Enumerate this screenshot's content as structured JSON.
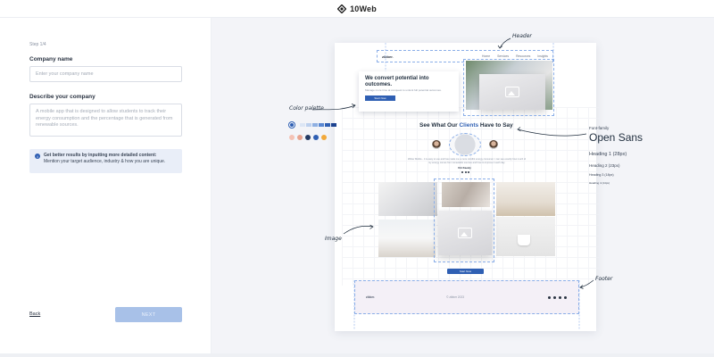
{
  "topbar": {
    "brand": "10Web",
    "logo_icon": "diamond-logo-icon"
  },
  "form": {
    "step": "Step 1/4",
    "company_name_label": "Company name",
    "company_name_placeholder": "Enter your company name",
    "describe_label": "Describe your company",
    "describe_placeholder": "A mobile app that is designed to allow students to track their energy consumption and the percentage that is generated from renewable sources.",
    "tip_title": "Get better results by inputting more detailed content:",
    "tip_body": "Mention your target audience, industry & how you are unique.",
    "back_label": "Back",
    "next_label": "NEXT"
  },
  "preview": {
    "header": {
      "logo": "zibber.",
      "nav": [
        "Home",
        "Services",
        "Resources",
        "Insights"
      ]
    },
    "hero": {
      "heading": "We convert potential into outcomes.",
      "text": "Manage more time at conquest to unlock full potential outcomes.",
      "button": "Start Now"
    },
    "testimonials": {
      "title_start": "See What Our ",
      "title_highlight": "Clients",
      "title_end": " Have to Say",
      "quote": "Zibber Mobile - it is easy to use and has made me a more mindful energy consumer. I can see exactly how much of my energy comes from renewable sources and how to improve it each day.",
      "name": "Viri Kaody"
    },
    "cta_button": "Start Now",
    "footer": {
      "logo": "zibber.",
      "middle": "© zibber 2023"
    }
  },
  "annotations": {
    "header": "Header",
    "color_palette": "Color palette",
    "image": "Image",
    "footer": "Footer",
    "font_family_label": "Font-family",
    "font_family": "Open Sans",
    "heading1": "Heading 1 (28px)",
    "heading2": "Heading 2 (23px)",
    "heading3": "Heading 3 (18px)",
    "heading4": "Heading 4 (14px)"
  },
  "palette": {
    "row1": [
      "#dce6f5",
      "#bcd0ee",
      "#8fb0e2",
      "#5a88d2",
      "#2f5fb3",
      "#1d4390"
    ],
    "row2": [
      "#f4c2b4",
      "#e8a48f",
      "#243a63",
      "#2f5fb3",
      "#f2a93b"
    ]
  },
  "colors": {
    "accent": "#2f5fb3",
    "next_disabled": "#a8c1e8",
    "tip_bg": "#e9eef8"
  }
}
